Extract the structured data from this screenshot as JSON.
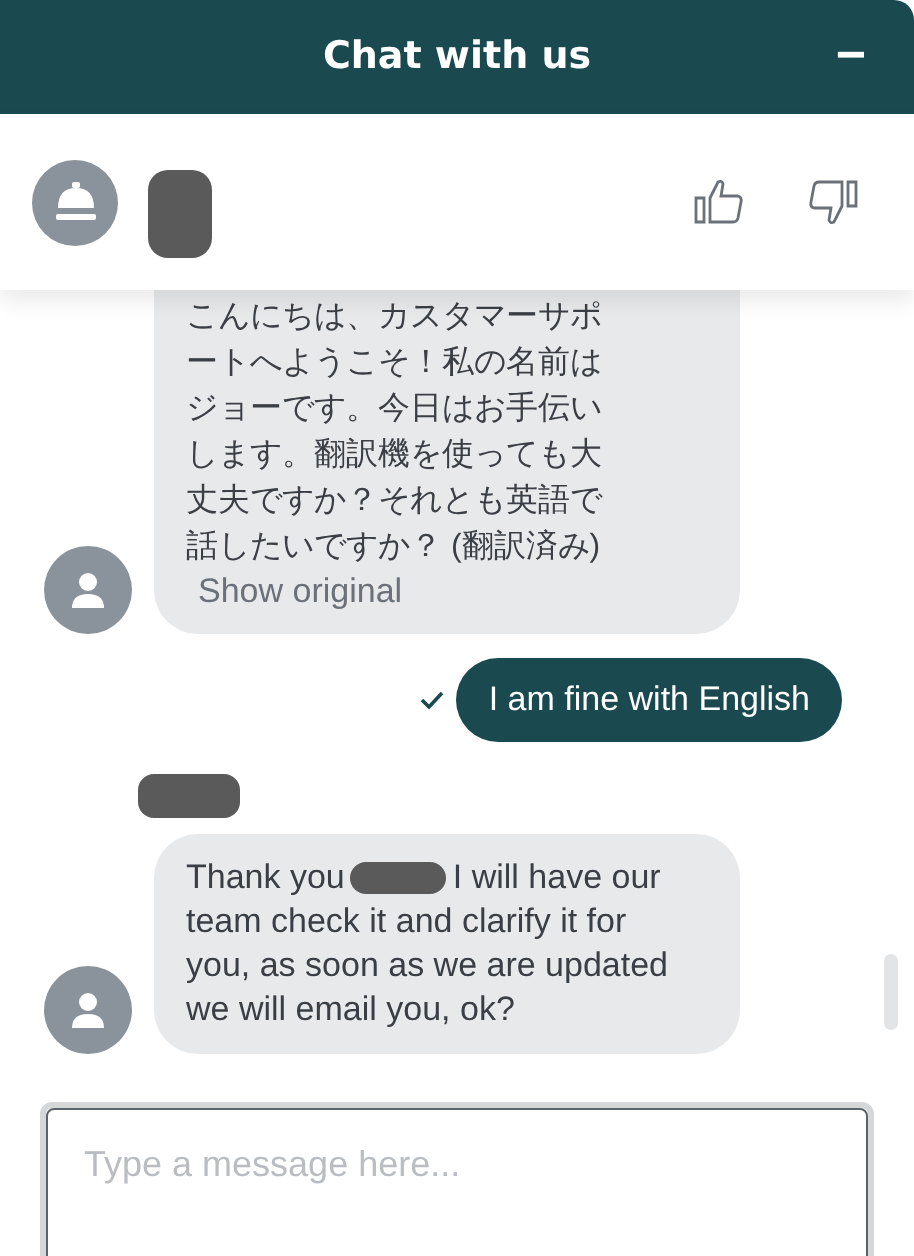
{
  "header": {
    "title": "Chat with us",
    "minimize": "−"
  },
  "agent_bar": {
    "name_redacted": true
  },
  "messages": [
    {
      "kind": "received",
      "lines": [
        "こんにちは、カスタマーサポ",
        "ートへようこそ！私の名前は",
        "ジョーです。今日はお手伝い",
        "します。翻訳機を使っても大",
        "丈夫ですか？それとも英語で",
        "話したいですか？ (翻訳済み)"
      ],
      "link": "Show original"
    },
    {
      "kind": "sent",
      "text": "I am fine with English",
      "delivered": true
    },
    {
      "kind": "sender_name",
      "redacted": true
    },
    {
      "kind": "received",
      "text_before": "Thank you",
      "redacted": true,
      "lines": [
        "I will have our",
        "team check it and clarify it for",
        "you, as soon as we are updated",
        "we will email you, ok?"
      ]
    }
  ],
  "composer": {
    "placeholder": "Type a message here..."
  }
}
